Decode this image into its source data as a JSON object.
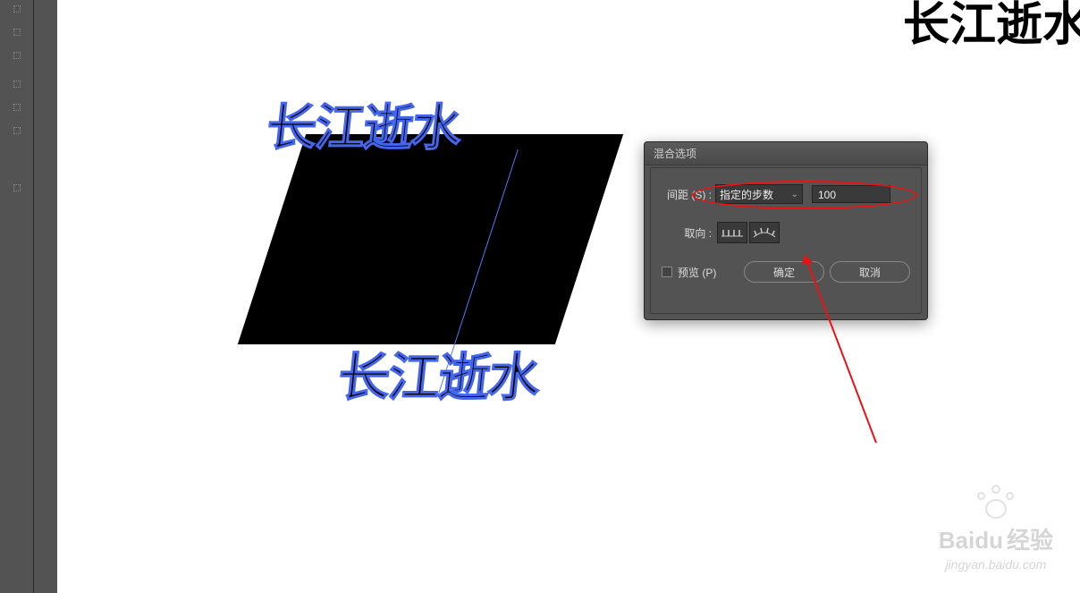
{
  "corner_text": "长江逝水",
  "artwork": {
    "text_top": "长江逝水",
    "text_bottom": "长江逝水"
  },
  "dialog": {
    "title": "混合选项",
    "spacing_label": "间距 (S) :",
    "spacing_method": "指定的步数",
    "spacing_value": "100",
    "orient_label": "取向 :",
    "preview_label": "预览 (P)",
    "ok_label": "确定",
    "cancel_label": "取消"
  },
  "watermark": {
    "brand": "Baidu",
    "brand_cn": "经验",
    "sub": "jingyan.baidu.com"
  }
}
